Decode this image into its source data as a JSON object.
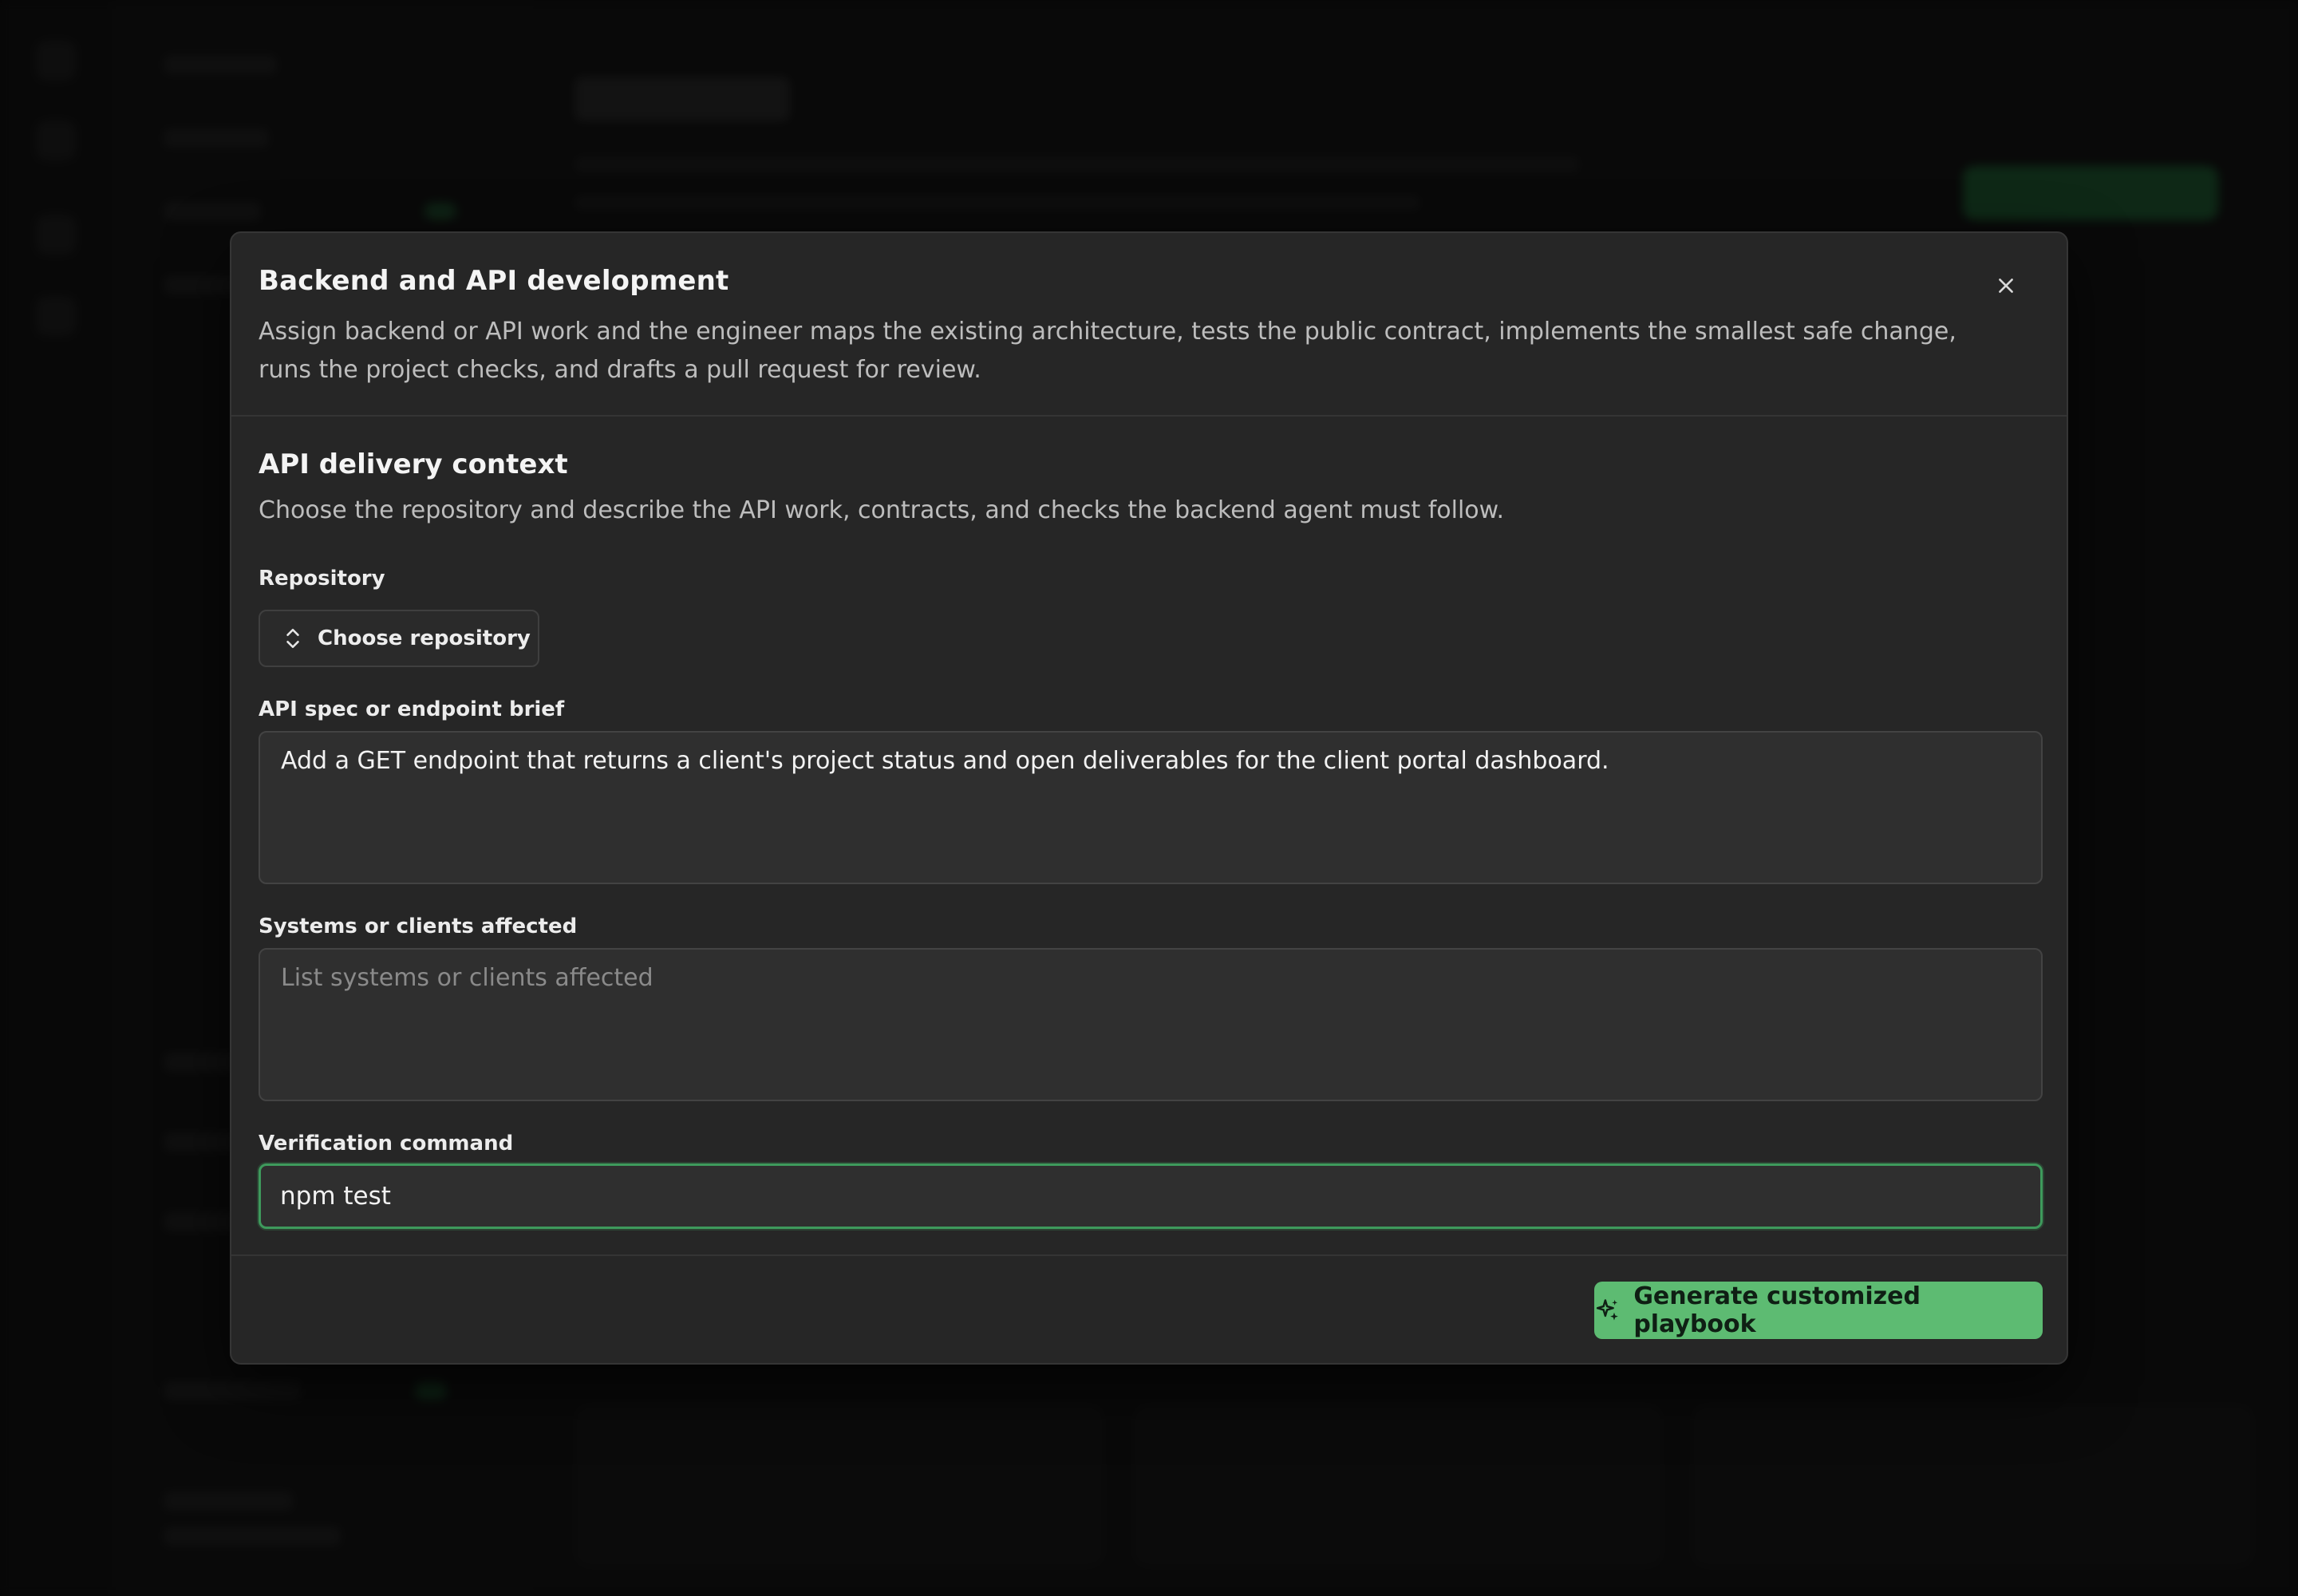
{
  "modal": {
    "title": "Backend and API development",
    "description": "Assign backend or API work and the engineer maps the existing architecture, tests the public contract, implements the smallest safe change, runs the project checks, and drafts a pull request for review.",
    "close_icon": "close-icon"
  },
  "section": {
    "title": "API delivery context",
    "description": "Choose the repository and describe the API work, contracts, and checks the backend agent must follow."
  },
  "fields": {
    "repository": {
      "label": "Repository",
      "button_label": "Choose repository",
      "icon": "chevron-up-down-icon"
    },
    "api_spec": {
      "label": "API spec or endpoint brief",
      "value": "Add a GET endpoint that returns a client's project status and open deliverables for the client portal dashboard."
    },
    "systems_affected": {
      "label": "Systems or clients affected",
      "value": "",
      "placeholder": "List systems or clients affected"
    },
    "verification_command": {
      "label": "Verification command",
      "value": "npm test"
    }
  },
  "footer": {
    "generate_label": "Generate customized playbook",
    "generate_icon": "sparkles-icon"
  },
  "colors": {
    "accent": "#5dbb72",
    "focus_border": "#3e9a5c",
    "modal_bg": "#262626"
  }
}
